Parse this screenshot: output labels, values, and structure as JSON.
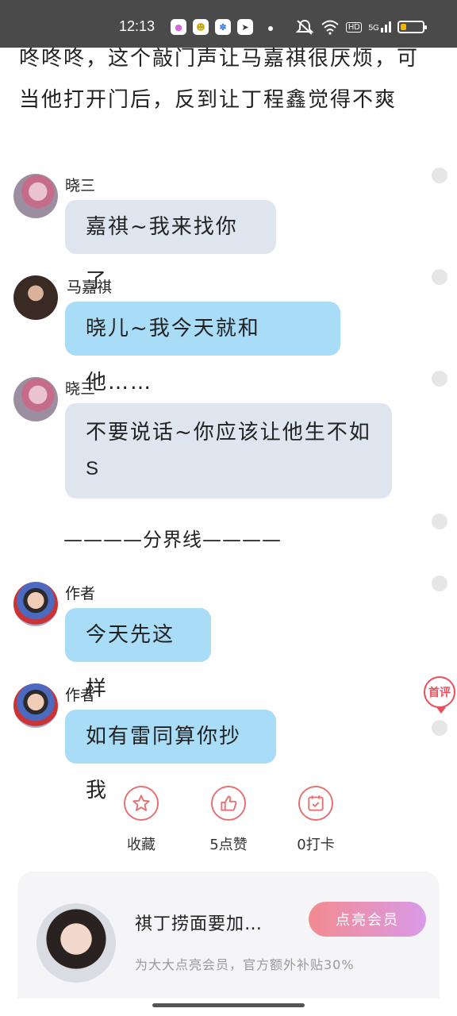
{
  "status_bar": {
    "time": "12:13",
    "network_label": "5G",
    "hd_label": "HD",
    "battery_level": 0.25,
    "icons": [
      "notification-app-icon",
      "emoji-app-icon",
      "paw-app-icon",
      "bolt-app-icon",
      "mute-icon",
      "wifi-icon",
      "hd-icon",
      "signal-icon",
      "battery-icon"
    ]
  },
  "story": {
    "text": "咚咚咚，这个敲门声让马嘉祺很厌烦，可当他打开门后，反到让丁程鑫觉得不爽"
  },
  "messages": [
    {
      "speaker": "晓三",
      "text": "嘉祺~我来找你了",
      "style": "gray"
    },
    {
      "speaker": "马嘉祺",
      "text": "晓儿~我今天就和他……",
      "style": "blue"
    },
    {
      "speaker": "晓三",
      "text_line1": "不要说话~你应该让他生不如",
      "text_line2": "S",
      "style": "gray"
    },
    {
      "speaker": "作者",
      "text": "今天先这样",
      "style": "blue"
    },
    {
      "speaker": "作者",
      "text": "如有雷同算你抄我",
      "style": "blue"
    }
  ],
  "divider": "————分界线————",
  "comment_badge": "首评",
  "actions": {
    "favorite": "收藏",
    "like": "5点赞",
    "checkin": "0打卡"
  },
  "vip": {
    "title": "祺丁捞面要加…",
    "subtitle": "为大大点亮会员，官方额外补贴30%",
    "button": "点亮会员"
  },
  "colors": {
    "bubble_gray": "#dfe5ee",
    "bubble_blue": "#a8dcf7",
    "accent_red": "#e57373",
    "vip_gradient_start": "#f38b8f",
    "vip_gradient_end": "#d99ae8"
  }
}
